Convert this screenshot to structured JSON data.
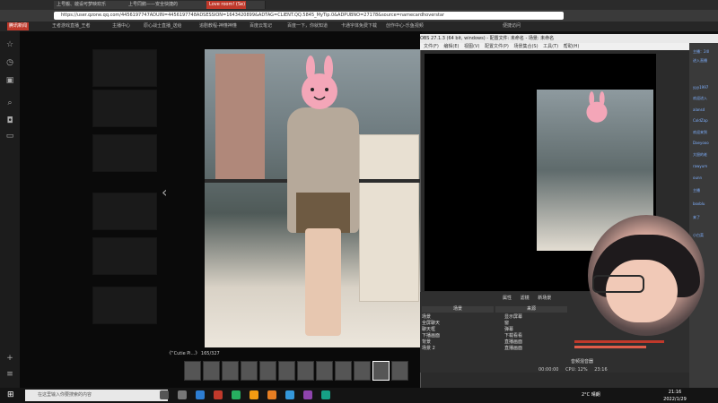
{
  "tabs": [
    {
      "label": "上号搬、啟设可梦映欢乐",
      "active": false
    },
    {
      "label": "上号同鹅——安全快捷的",
      "active": false
    },
    {
      "label": "Love room! (Se)",
      "active": true
    },
    {
      "label": "",
      "active": false
    }
  ],
  "address": "https://user.qzone.qq.com/4456197747ADUIN=4456197748ADSESSION=1643420899&ADTAG=CLIENT.QQ.5845_MyTip.0&ADPUBNO=27178&source=namecardhoverstar",
  "bookmarks": [
    {
      "label": "腾讯新闻",
      "red": true
    },
    {
      "label": "王者游戏直播_王者"
    },
    {
      "label": "主播中心"
    },
    {
      "label": "原心战士直播_送给"
    },
    {
      "label": "追剧教程-神懂神懂"
    },
    {
      "label": "百度云笔记"
    },
    {
      "label": "百度一下，你就知道"
    },
    {
      "label": "卡通字体免费下载"
    },
    {
      "label": "创作中心-乐鱼视频"
    },
    {
      "label": "便捷访问"
    }
  ],
  "viewer": {
    "caption": "《“Cutie Pi...》 165/327",
    "film_count": 12,
    "selected_index": 10
  },
  "obs": {
    "title": "OBS 27.1.3 (64 bit, windows) - 配置文件: 未命名 - 场景: 未命名",
    "menu": [
      "文件(F)",
      "编辑(E)",
      "视图(V)",
      "配置文件(P)",
      "场景集合(S)",
      "工具(T)",
      "帮助(H)"
    ],
    "source_bar": [
      "属性",
      "滤镜",
      "新场景"
    ],
    "scenes_header": "场景",
    "sources_header": "来源",
    "scenes": [
      "场景",
      "全屏聊天",
      "聊天框",
      "下播画面",
      "背景",
      "场景 2"
    ],
    "sources": [
      "显示屏幕",
      "窗",
      "弹幕",
      "下载看看",
      "直播画面",
      "直播画面"
    ],
    "mixer_label": "音频混音器",
    "time": "00:00:00",
    "fps": "CPU: 12%",
    "status": "23:16"
  },
  "chat": [
    "主播：24l",
    "进入直播",
    "yyy1997",
    "欢迎进入",
    "alansd",
    "ColdZap",
    "欢迎来到",
    "Daeyooo",
    "大胆的老",
    "rawyum",
    "ounn",
    "主播",
    "boxblu",
    "来了",
    "小白菜"
  ],
  "taskbar": {
    "search_placeholder": "在这里输入你要搜索的内容",
    "weather": "2°C 晴朗",
    "time": "21:16",
    "date": "2022/1/29"
  },
  "colors": {
    "accent": "#c0392b",
    "obs_bg": "#2b2b2b"
  }
}
